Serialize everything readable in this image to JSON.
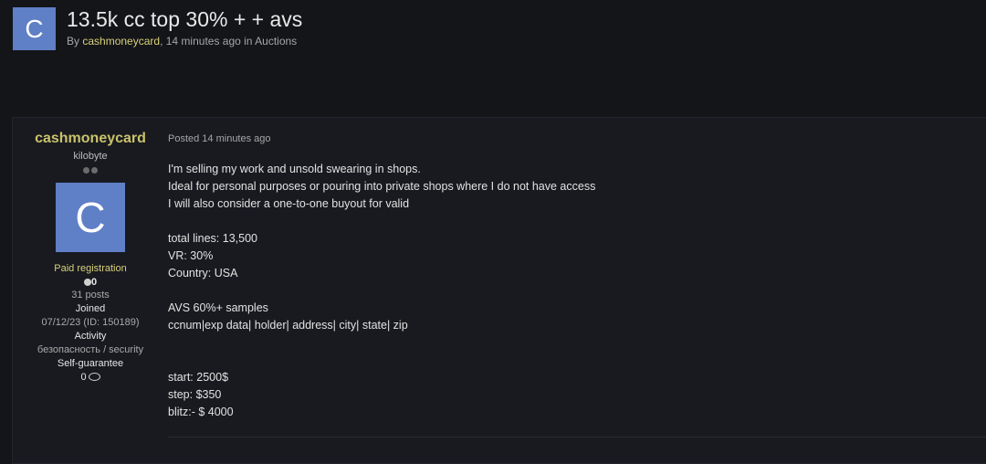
{
  "topic": {
    "avatar_letter": "C",
    "title": "13.5k cc top 30% + + avs",
    "by_label": "By",
    "author": "cashmoneycard",
    "meta_suffix": ", 14 minutes ago in Auctions"
  },
  "author": {
    "name": "cashmoneycard",
    "user_title": "kilobyte",
    "avatar_letter": "C",
    "group": "Paid registration",
    "reputation": "0",
    "posts": "31 posts",
    "joined_label": "Joined",
    "joined_value": "07/12/23 (ID: 150189)",
    "activity_label": "Activity",
    "activity_value": "безопасность / security",
    "guarantee_label": "Self-guarantee",
    "guarantee_value": "0"
  },
  "post": {
    "date": "Posted 14 minutes ago",
    "lines": [
      "I'm selling my work and unsold swearing in shops.",
      "Ideal for personal purposes or pouring into private shops where I do not have access",
      "I will also consider a one-to-one buyout for valid",
      "",
      "total lines: 13,500",
      "VR: 30%",
      "Country: USA",
      "",
      "AVS 60%+ samples",
      "ccnum|exp data| holder| address| city| state| zip",
      "",
      "",
      "start: 2500$",
      "step: $350",
      "blitz:- $ 4000"
    ]
  },
  "colors": {
    "background": "#141519",
    "accent_yellow": "#c9c36a",
    "avatar_blue": "#5f7fc6"
  }
}
